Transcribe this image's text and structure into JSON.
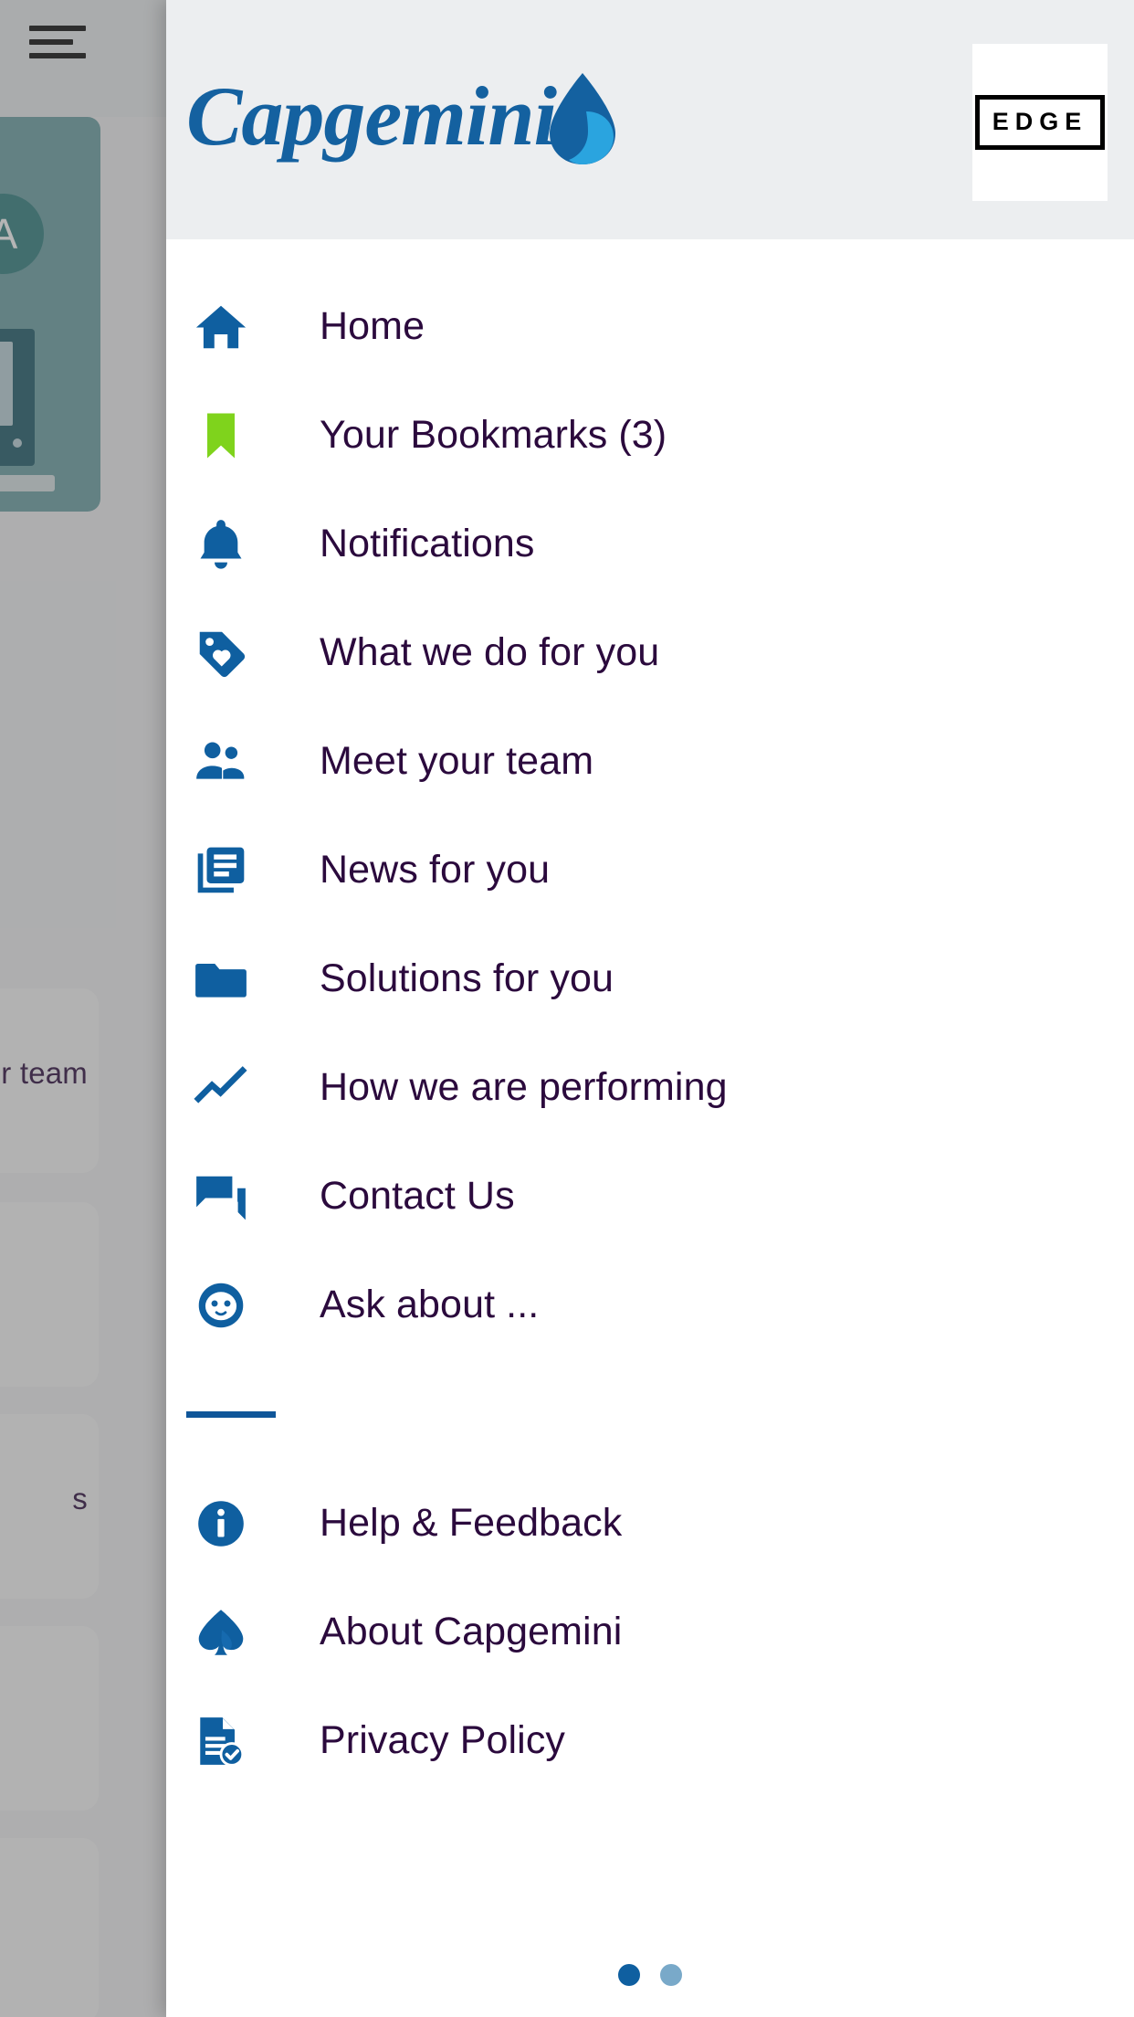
{
  "background": {
    "hamburger_icon": "hamburger-menu-icon",
    "avatar_initial": "A",
    "cards": [
      {
        "label": "r team"
      },
      {
        "label": ""
      },
      {
        "label": "s"
      },
      {
        "label": ""
      },
      {
        "label": ""
      }
    ]
  },
  "header": {
    "logo_text": "Capgemini",
    "logo_icon": "capgemini-spade-logo",
    "badge_text": "EDGE"
  },
  "nav": {
    "items": [
      {
        "label": "Home",
        "icon": "home-icon",
        "color": "#0f5fa0"
      },
      {
        "label": "Your Bookmarks (3)",
        "icon": "bookmark-icon",
        "color": "#7fd31c"
      },
      {
        "label": "Notifications",
        "icon": "bell-icon",
        "color": "#0f5fa0"
      },
      {
        "label": "What we do for you",
        "icon": "tag-heart-icon",
        "color": "#0f5fa0"
      },
      {
        "label": "Meet your team",
        "icon": "people-icon",
        "color": "#0f5fa0"
      },
      {
        "label": "News for you",
        "icon": "news-article-icon",
        "color": "#0f5fa0"
      },
      {
        "label": "Solutions for you",
        "icon": "folder-icon",
        "color": "#0f5fa0"
      },
      {
        "label": "How we are performing",
        "icon": "trend-line-icon",
        "color": "#0f5fa0"
      },
      {
        "label": "Contact Us",
        "icon": "chat-bubbles-icon",
        "color": "#0f5fa0"
      },
      {
        "label": "Ask about ...",
        "icon": "chatbot-face-icon",
        "color": "#0f5fa0"
      }
    ],
    "secondary_items": [
      {
        "label": "Help & Feedback",
        "icon": "info-circle-icon",
        "color": "#0f5fa0"
      },
      {
        "label": "About Capgemini",
        "icon": "spade-icon",
        "color": "#0f5fa0"
      },
      {
        "label": "Privacy Policy",
        "icon": "document-check-icon",
        "color": "#0f5fa0"
      }
    ]
  },
  "pagination": {
    "total": 2,
    "active_index": 0,
    "active_color": "#0f5fa0",
    "inactive_color": "#79a9c9"
  },
  "colors": {
    "brand_blue": "#0f5fa0",
    "accent_green": "#7fd31c",
    "text_dark": "#2b0a3d",
    "header_bg": "#eceef0"
  }
}
